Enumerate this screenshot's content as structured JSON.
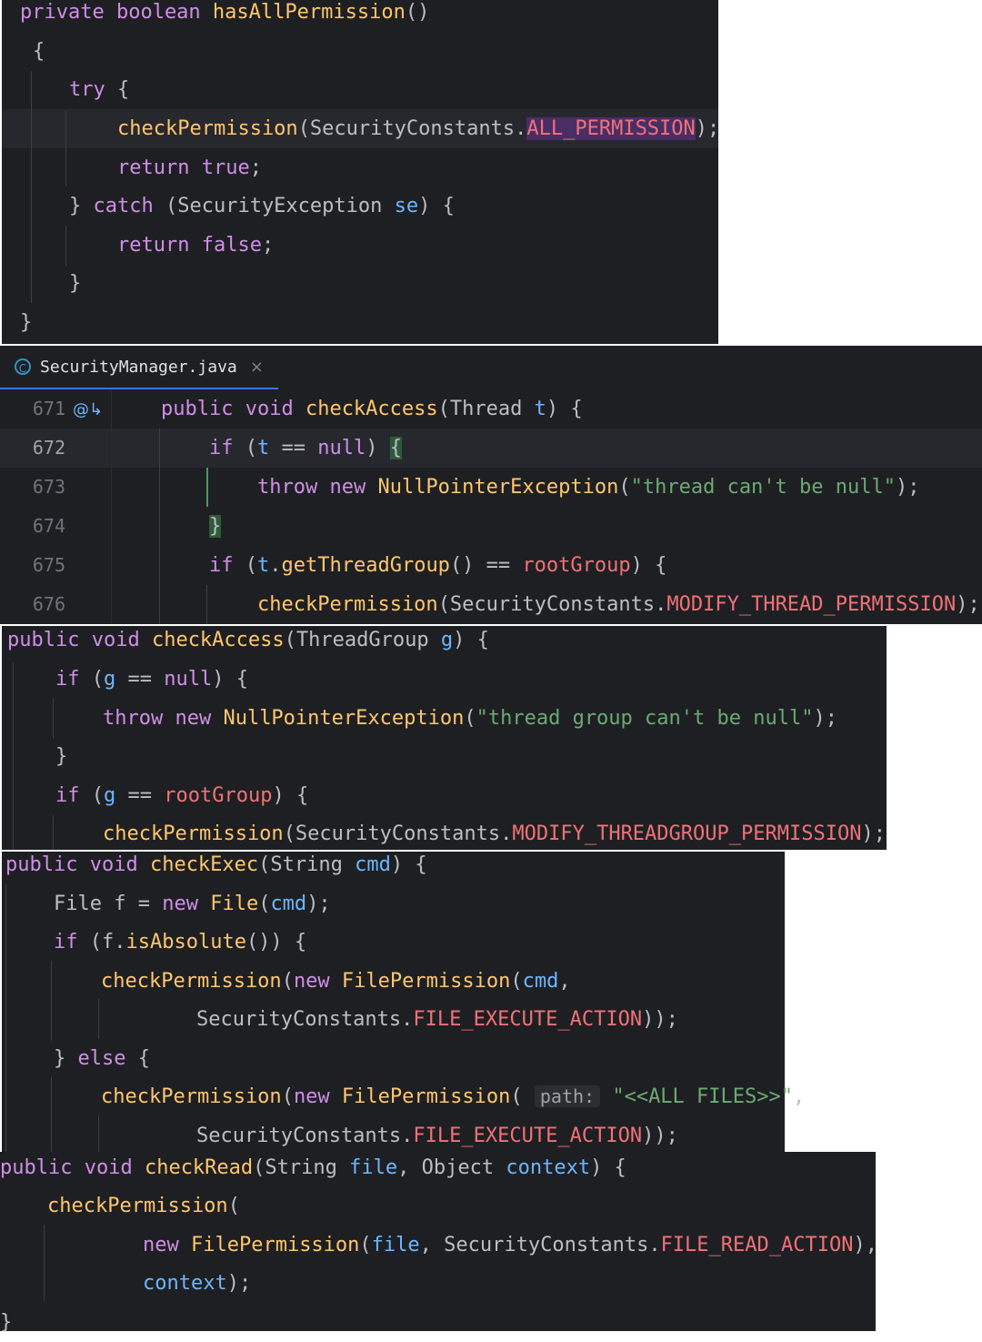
{
  "colors": {
    "background": "#1e1f22",
    "keyword": "#cf8ee8",
    "method": "#ffc66d",
    "string": "#6aab73",
    "parameter": "#6cb6ff",
    "constant": "#f07178",
    "text": "#bcbec4"
  },
  "snippet1": {
    "l1a": "private boolean ",
    "l1b": "hasAllPermission",
    "l1c": "()",
    "l2": "{",
    "l3a": "try",
    "l3b": " {",
    "l4a": "checkPermission",
    "l4b": "(SecurityConstants.",
    "l4c": "ALL_PERMISSION",
    "l4d": ");",
    "l5a": "return true",
    "l5b": ";",
    "l6a": "} ",
    "l6b": "catch",
    "l6c": " (SecurityException ",
    "l6d": "se",
    "l6e": ") {",
    "l7a": "return false",
    "l7b": ";",
    "l8": "}",
    "l9": "}"
  },
  "editor": {
    "tab_title": "SecurityManager.java",
    "tab_icon": "class-icon",
    "close_glyph": "×",
    "line_numbers": [
      "671",
      "672",
      "673",
      "674",
      "675",
      "676"
    ],
    "l671a": "public void ",
    "l671b": "checkAccess",
    "l671c": "(Thread ",
    "l671d": "t",
    "l671e": ") {",
    "l672a": "if",
    "l672b": " (",
    "l672c": "t",
    "l672d": " == ",
    "l672e": "null",
    "l672f": ") ",
    "l672g": "{",
    "l673a": "throw new ",
    "l673b": "NullPointerException",
    "l673c": "(",
    "l673d": "\"thread can't be null\"",
    "l673e": ");",
    "l674": "}",
    "l675a": "if",
    "l675b": " (",
    "l675c": "t",
    "l675d": ".",
    "l675e": "getThreadGroup",
    "l675f": "() == ",
    "l675g": "rootGroup",
    "l675h": ") {",
    "l676a": "checkPermission",
    "l676b": "(SecurityConstants.",
    "l676c": "MODIFY_THREAD_PERMISSION",
    "l676d": ");"
  },
  "snippet3": {
    "l1a": "public void ",
    "l1b": "checkAccess",
    "l1c": "(ThreadGroup ",
    "l1d": "g",
    "l1e": ") {",
    "l2a": "if",
    "l2b": " (",
    "l2c": "g",
    "l2d": " == ",
    "l2e": "null",
    "l2f": ") {",
    "l3a": "throw new ",
    "l3b": "NullPointerException",
    "l3c": "(",
    "l3d": "\"thread group can't be null\"",
    "l3e": ");",
    "l4": "}",
    "l5a": "if",
    "l5b": " (",
    "l5c": "g",
    "l5d": " == ",
    "l5e": "rootGroup",
    "l5f": ") {",
    "l6a": "checkPermission",
    "l6b": "(SecurityConstants.",
    "l6c": "MODIFY_THREADGROUP_PERMISSION",
    "l6d": ");"
  },
  "snippet4": {
    "l1a": "public void ",
    "l1b": "checkExec",
    "l1c": "(String ",
    "l1d": "cmd",
    "l1e": ") {",
    "l2a": "File f = ",
    "l2b": "new ",
    "l2c": "File",
    "l2d": "(",
    "l2e": "cmd",
    "l2f": ");",
    "l3a": "if",
    "l3b": " (f.",
    "l3c": "isAbsolute",
    "l3d": "()) {",
    "l4a": "checkPermission",
    "l4b": "(",
    "l4c": "new ",
    "l4d": "FilePermission",
    "l4e": "(",
    "l4f": "cmd",
    "l4g": ",",
    "l5a": "SecurityConstants.",
    "l5b": "FILE_EXECUTE_ACTION",
    "l5c": "));",
    "l6a": "} ",
    "l6b": "else",
    "l6c": " {",
    "l7a": "checkPermission",
    "l7b": "(",
    "l7c": "new ",
    "l7d": "FilePermission",
    "l7e": "( ",
    "l7hint": "path:",
    "l7f": " ",
    "l7g": "\"<<ALL FILES>>\"",
    "l7h": ",",
    "l8a": "SecurityConstants.",
    "l8b": "FILE_EXECUTE_ACTION",
    "l8c": "));"
  },
  "snippet5": {
    "l1a": "public void ",
    "l1b": "checkRead",
    "l1c": "(String ",
    "l1d": "file",
    "l1e": ", Object ",
    "l1f": "context",
    "l1g": ") {",
    "l2a": "checkPermission",
    "l2b": "(",
    "l3a": "new ",
    "l3b": "FilePermission",
    "l3c": "(",
    "l3d": "file",
    "l3e": ", SecurityConstants.",
    "l3f": "FILE_READ_ACTION",
    "l3g": "),",
    "l4a": "context",
    "l4b": ");",
    "l5": "}"
  }
}
